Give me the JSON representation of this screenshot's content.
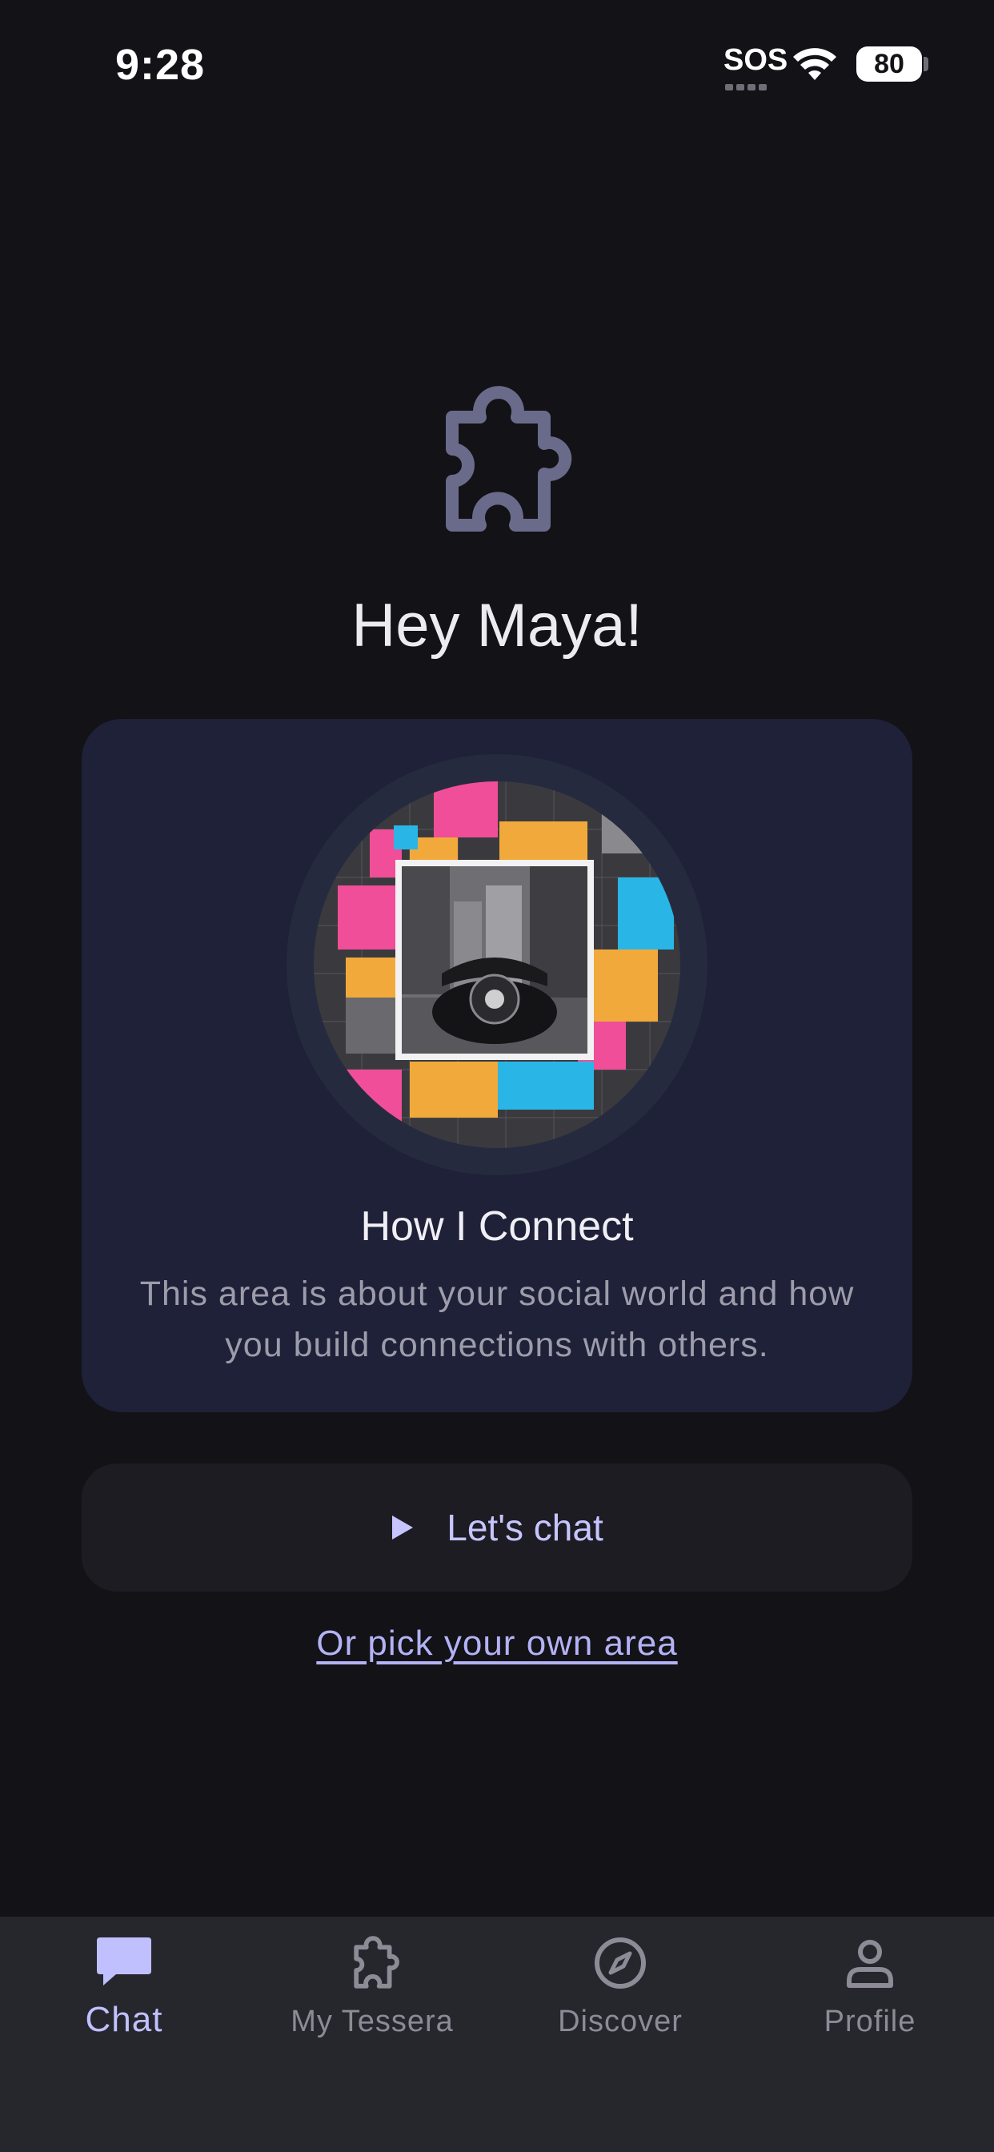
{
  "status_bar": {
    "time": "9:28",
    "sos": "SOS",
    "battery": "80"
  },
  "hero": {
    "icon": "puzzle-piece-icon",
    "greeting": "Hey Maya!"
  },
  "area_card": {
    "image": "collage-rotary-telephone-city-street",
    "title": "How I Connect",
    "description": "This area is about your social world and how you build connections with others."
  },
  "cta": {
    "icon": "play-icon",
    "label": "Let's chat"
  },
  "pick_link": "Or pick your own area",
  "tabs": [
    {
      "label": "Chat",
      "icon": "chat-bubble-icon",
      "active": true
    },
    {
      "label": "My Tessera",
      "icon": "puzzle-piece-icon",
      "active": false
    },
    {
      "label": "Discover",
      "icon": "compass-icon",
      "active": false
    },
    {
      "label": "Profile",
      "icon": "person-icon",
      "active": false
    }
  ],
  "colors": {
    "background": "#121217",
    "card": "#1E2137",
    "button": "#1C1C22",
    "accent": "#C0C0FF",
    "tab_bar": "#26262D",
    "muted": "#8C8B96"
  }
}
